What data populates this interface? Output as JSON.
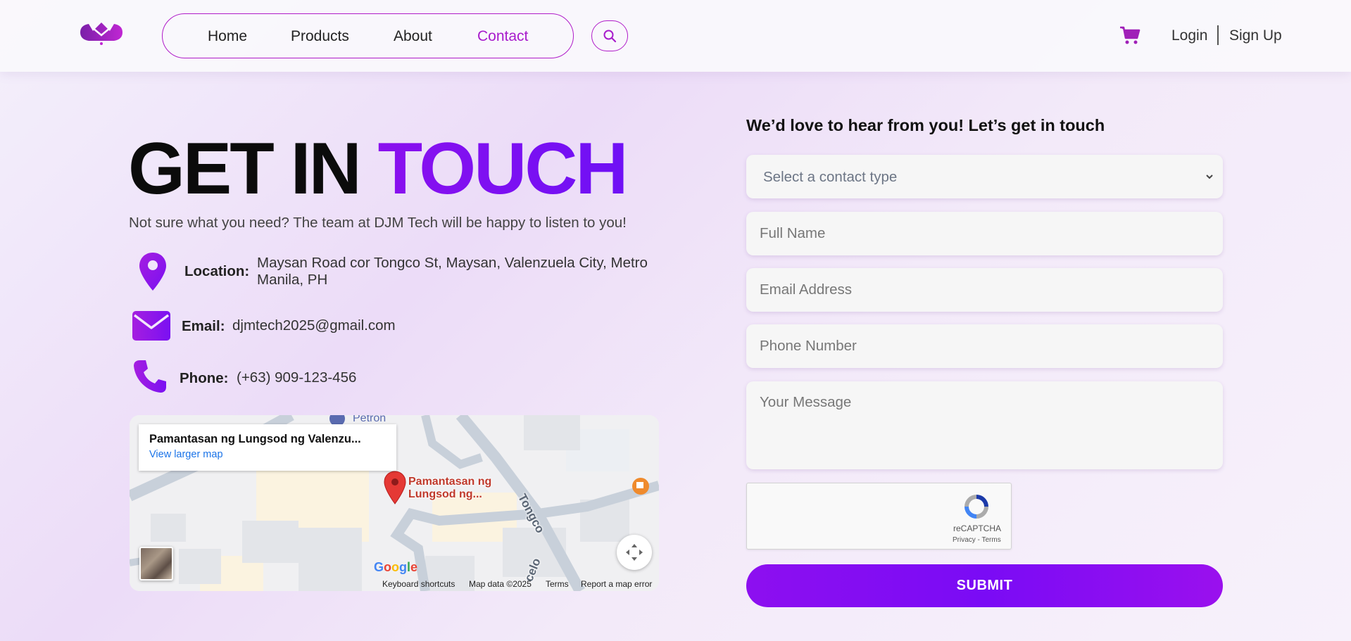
{
  "header": {
    "nav": [
      {
        "label": "Home"
      },
      {
        "label": "Products"
      },
      {
        "label": "About"
      },
      {
        "label": "Contact",
        "active": true
      }
    ],
    "login_label": "Login",
    "signup_label": "Sign Up"
  },
  "hero": {
    "title_part1": "GET IN",
    "title_part2": "TOUCH",
    "subtitle": "Not sure what you need? The team at DJM Tech will be happy to listen to you!"
  },
  "contact_info": {
    "location_label": "Location:",
    "location_value_line1": "Maysan Road cor Tongco St, Maysan, Valenzuela City, Metro",
    "location_value_line2": "Manila, PH",
    "email_label": "Email:",
    "email_value": "djmtech2025@gmail.com",
    "phone_label": "Phone:",
    "phone_value": "(+63) 909-123-456"
  },
  "map": {
    "card_title": "Pamantasan ng Lungsod ng Valenzu...",
    "card_link": "View larger map",
    "place_label_line1": "Pamantasan ng",
    "place_label_line2": "Lungsod ng...",
    "petron_label": "Petron",
    "road_label_1": "Tongco",
    "road_label_2": "celo",
    "google_label": "Google",
    "footer": [
      "Keyboard shortcuts",
      "Map data ©2025",
      "Terms",
      "Report a map error"
    ]
  },
  "form": {
    "heading": "We’d love to hear from you! Let’s get in touch",
    "contact_type_placeholder": "Select a contact type",
    "full_name_placeholder": "Full Name",
    "email_placeholder": "Email Address",
    "phone_placeholder": "Phone Number",
    "message_placeholder": "Your Message",
    "recaptcha_label": "reCAPTCHA",
    "recaptcha_links": "Privacy - Terms",
    "submit_label": "SUBMIT"
  },
  "colors": {
    "accent": "#a81ccc",
    "brand_purple": "#7a0bf5"
  }
}
